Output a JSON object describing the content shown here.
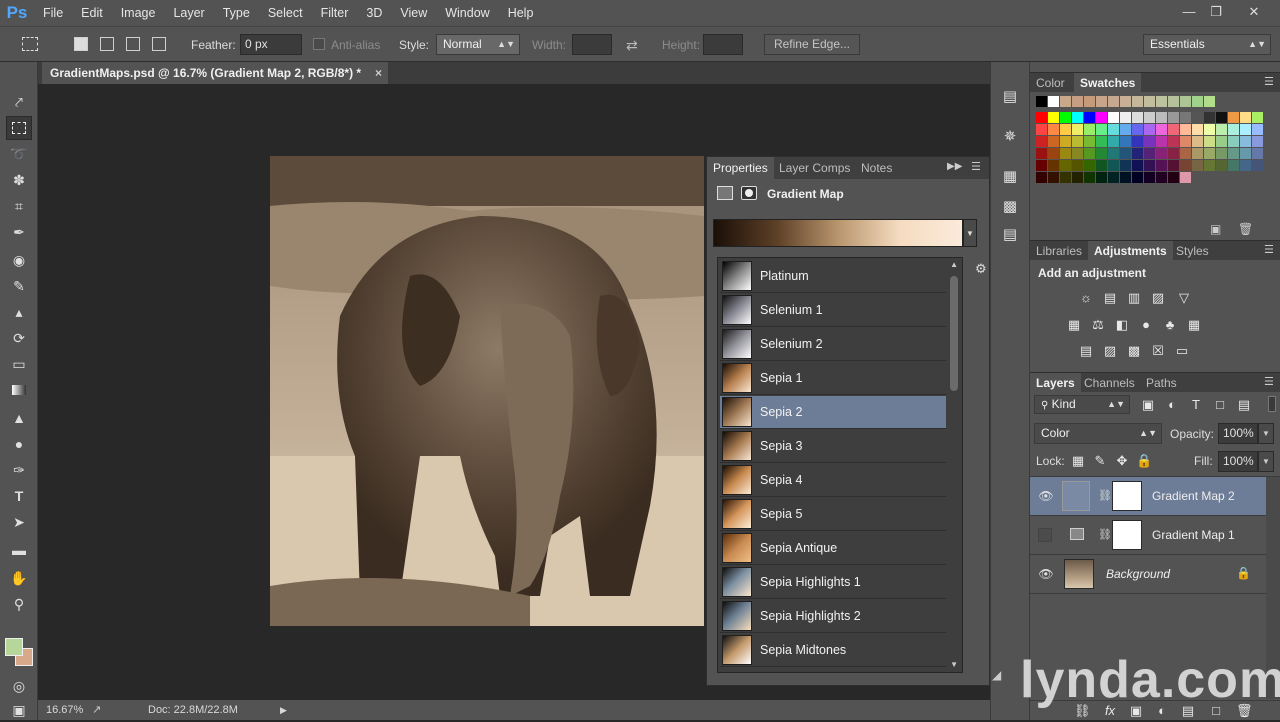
{
  "app": {
    "logo": "Ps"
  },
  "menu": [
    "File",
    "Edit",
    "Image",
    "Layer",
    "Type",
    "Select",
    "Filter",
    "3D",
    "View",
    "Window",
    "Help"
  ],
  "window_controls": [
    "minimize-icon",
    "restore-icon",
    "close-icon"
  ],
  "options": {
    "feather_label": "Feather:",
    "feather_value": "0 px",
    "antialias_label": "Anti-alias",
    "style_label": "Style:",
    "style_value": "Normal",
    "width_label": "Width:",
    "height_label": "Height:",
    "refine_label": "Refine Edge...",
    "workspace": "Essentials"
  },
  "document": {
    "tab_title": "GradientMaps.psd @ 16.7% (Gradient Map 2, RGB/8*) *",
    "zoom": "16.67%",
    "doc_info": "Doc: 22.8M/22.8M"
  },
  "properties": {
    "tabs": [
      "Properties",
      "Layer Comps",
      "Notes"
    ],
    "title": "Gradient Map",
    "presets": [
      {
        "label": "Platinum",
        "selected": false
      },
      {
        "label": "Selenium 1",
        "selected": false
      },
      {
        "label": "Selenium 2",
        "selected": false
      },
      {
        "label": "Sepia 1",
        "selected": false
      },
      {
        "label": "Sepia 2",
        "selected": true
      },
      {
        "label": "Sepia 3",
        "selected": false
      },
      {
        "label": "Sepia 4",
        "selected": false
      },
      {
        "label": "Sepia 5",
        "selected": false
      },
      {
        "label": "Sepia Antique",
        "selected": false
      },
      {
        "label": "Sepia Highlights 1",
        "selected": false
      },
      {
        "label": "Sepia Highlights 2",
        "selected": false
      },
      {
        "label": "Sepia Midtones",
        "selected": false
      }
    ]
  },
  "color_panel": {
    "tabs": [
      "Color",
      "Swatches"
    ]
  },
  "adjustments_panel": {
    "tabs": [
      "Libraries",
      "Adjustments",
      "Styles"
    ],
    "heading": "Add an adjustment"
  },
  "layers_panel": {
    "tabs": [
      "Layers",
      "Channels",
      "Paths"
    ],
    "kind_label": "Kind",
    "blend_mode": "Color",
    "opacity_label": "Opacity:",
    "opacity_value": "100%",
    "lock_label": "Lock:",
    "fill_label": "Fill:",
    "fill_value": "100%",
    "layers": [
      {
        "name": "Gradient Map 2",
        "visible": true,
        "selected": true
      },
      {
        "name": "Gradient Map 1",
        "visible": false,
        "selected": false
      },
      {
        "name": "Background",
        "visible": true,
        "selected": false
      }
    ]
  },
  "watermark": "lynda.com"
}
